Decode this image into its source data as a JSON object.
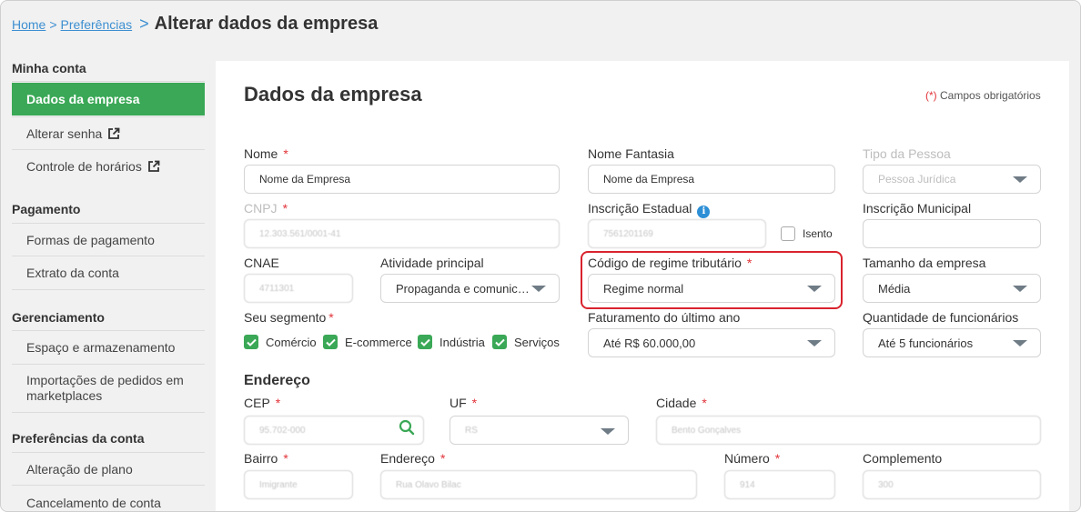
{
  "breadcrumb": {
    "home": "Home",
    "sep": ">",
    "prefs": "Preferências",
    "current": "Alterar dados da empresa"
  },
  "sidebar": {
    "sections": [
      {
        "title": "Minha conta"
      },
      {
        "title": "Pagamento"
      },
      {
        "title": "Gerenciamento"
      },
      {
        "title": "Preferências da conta"
      }
    ],
    "items": [
      {
        "label": "Dados da empresa"
      },
      {
        "label": "Alterar senha"
      },
      {
        "label": "Controle de horários"
      },
      {
        "label": "Formas de pagamento"
      },
      {
        "label": "Extrato da conta"
      },
      {
        "label": "Espaço e armazenamento"
      },
      {
        "label": "Importações de pedidos em marketplaces"
      },
      {
        "label": "Alteração de plano"
      },
      {
        "label": "Cancelamento de conta"
      }
    ]
  },
  "form": {
    "title": "Dados da empresa",
    "required_note_marker": "(*)",
    "required_note": "Campos obrigatórios",
    "required_star": "*",
    "nome": {
      "label": "Nome",
      "value": "Nome da Empresa"
    },
    "nome_fantasia": {
      "label": "Nome Fantasia",
      "value": "Nome da Empresa"
    },
    "tipo_pessoa": {
      "label": "Tipo da Pessoa",
      "value": "Pessoa Jurídica"
    },
    "cnpj": {
      "label": "CNPJ",
      "value": "12.303.561/0001-41"
    },
    "inscricao_estadual": {
      "label": "Inscrição Estadual",
      "value": "7561201169",
      "isento_label": "Isento",
      "isento_checked": false
    },
    "inscricao_municipal": {
      "label": "Inscrição Municipal",
      "value": ""
    },
    "cnae": {
      "label": "CNAE",
      "value": "4711301"
    },
    "atividade": {
      "label": "Atividade principal",
      "value": "Propaganda e comunic…"
    },
    "regime": {
      "label": "Código de regime tributário",
      "value": "Regime normal"
    },
    "tamanho": {
      "label": "Tamanho da empresa",
      "value": "Média"
    },
    "segmento": {
      "label": "Seu segmento",
      "options": [
        {
          "label": "Comércio",
          "checked": true
        },
        {
          "label": "E-commerce",
          "checked": true
        },
        {
          "label": "Indústria",
          "checked": true
        },
        {
          "label": "Serviços",
          "checked": true
        }
      ]
    },
    "faturamento": {
      "label": "Faturamento do último ano",
      "value": "Até R$ 60.000,00"
    },
    "funcionarios": {
      "label": "Quantidade de funcionários",
      "value": "Até 5 funcionários"
    },
    "endereco_title": "Endereço",
    "cep": {
      "label": "CEP",
      "value": "95.702-000"
    },
    "uf": {
      "label": "UF",
      "value": "RS"
    },
    "cidade": {
      "label": "Cidade",
      "value": "Bento Gonçalves"
    },
    "bairro": {
      "label": "Bairro",
      "value": "Imigrante"
    },
    "endereco": {
      "label": "Endereço",
      "value": "Rua Olavo Bilac"
    },
    "numero": {
      "label": "Número",
      "value": "914"
    },
    "complemento": {
      "label": "Complemento",
      "value": "300"
    }
  },
  "colors": {
    "accent": "#3aa856",
    "link": "#3d8fd1",
    "required": "#e2343a",
    "highlight": "#d9232d"
  },
  "icons": {
    "external": "external-link-icon",
    "search": "search-icon",
    "info": "info-icon",
    "check": "check-icon",
    "caret": "chevron-down-icon"
  }
}
